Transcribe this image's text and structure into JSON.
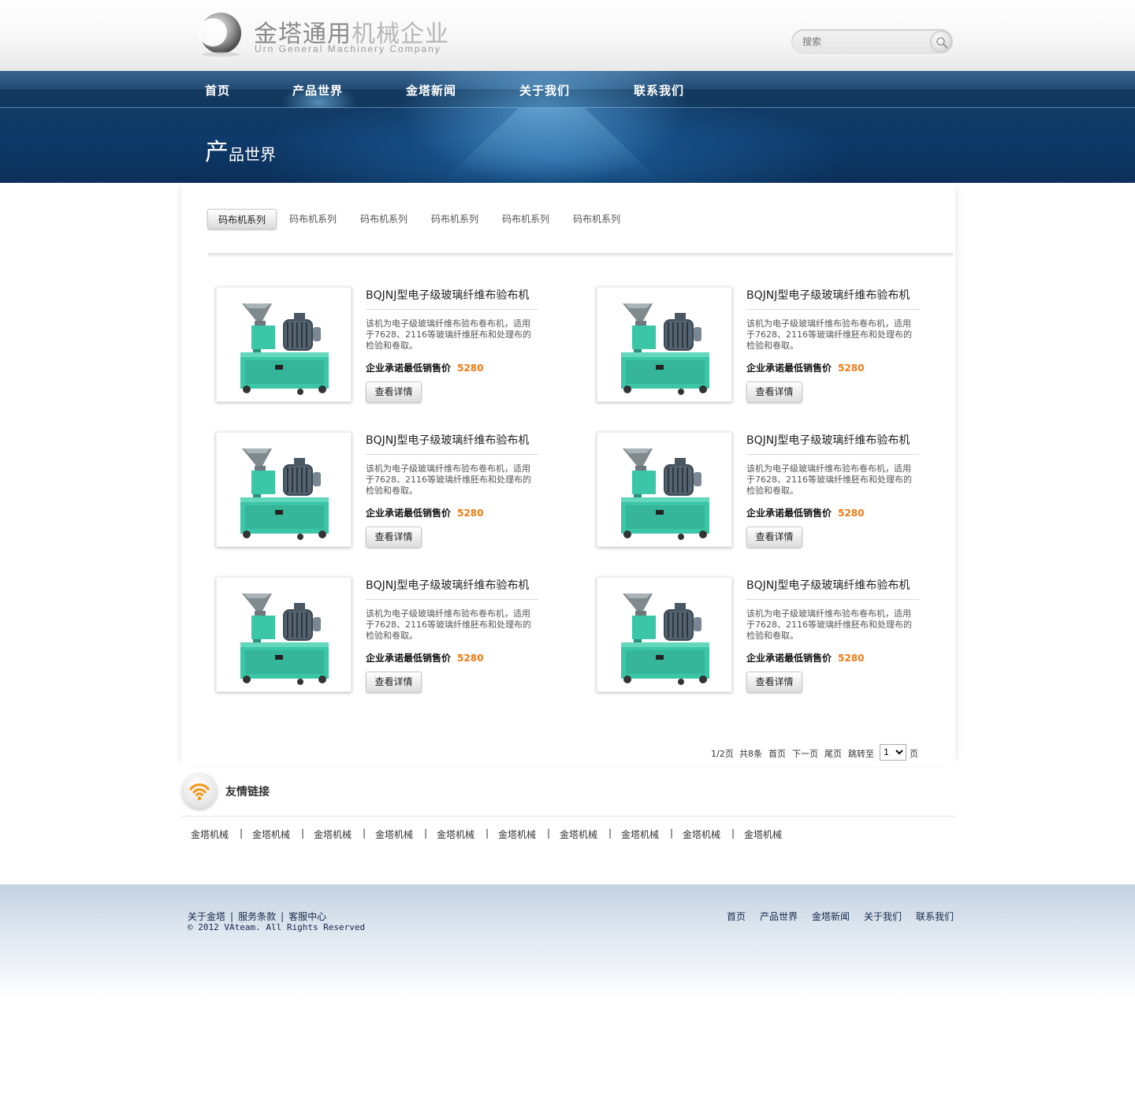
{
  "header": {
    "logo_cn_part1": "金塔通用",
    "logo_cn_part2": "机械企业",
    "logo_en": "Urn General Machinery Company",
    "search_placeholder": "搜索",
    "search_icon": "magnifier-icon"
  },
  "nav": {
    "items": [
      {
        "label": "首页"
      },
      {
        "label": "产品世界"
      },
      {
        "label": "金塔新闻"
      },
      {
        "label": "关于我们"
      },
      {
        "label": "联系我们"
      }
    ],
    "active": "产品世界"
  },
  "banner": {
    "title_big": "产",
    "title_rest": "品世界"
  },
  "tabs": [
    {
      "label": "码布机系列",
      "active": true
    },
    {
      "label": "码布机系列"
    },
    {
      "label": "码布机系列"
    },
    {
      "label": "码布机系列"
    },
    {
      "label": "码布机系列"
    },
    {
      "label": "码布机系列"
    }
  ],
  "products": [
    {
      "title": "BQJNJ型电子级玻璃纤维布验布机",
      "desc": "该机为电子级玻璃纤维布验布卷布机，适用于7628、2116等玻璃纤维胚布和处理布的检验和卷取。",
      "price_label": "企业承诺最低销售价",
      "price": "5280",
      "button": "查看详情"
    },
    {
      "title": "BQJNJ型电子级玻璃纤维布验布机",
      "desc": "该机为电子级玻璃纤维布验布卷布机，适用于7628、2116等玻璃纤维胚布和处理布的检验和卷取。",
      "price_label": "企业承诺最低销售价",
      "price": "5280",
      "button": "查看详情"
    },
    {
      "title": "BQJNJ型电子级玻璃纤维布验布机",
      "desc": "该机为电子级玻璃纤维布验布卷布机，适用于7628、2116等玻璃纤维胚布和处理布的检验和卷取。",
      "price_label": "企业承诺最低销售价",
      "price": "5280",
      "button": "查看详情"
    },
    {
      "title": "BQJNJ型电子级玻璃纤维布验布机",
      "desc": "该机为电子级玻璃纤维布验布卷布机，适用于7628、2116等玻璃纤维胚布和处理布的检验和卷取。",
      "price_label": "企业承诺最低销售价",
      "price": "5280",
      "button": "查看详情"
    },
    {
      "title": "BQJNJ型电子级玻璃纤维布验布机",
      "desc": "该机为电子级玻璃纤维布验布卷布机，适用于7628、2116等玻璃纤维胚布和处理布的检验和卷取。",
      "price_label": "企业承诺最低销售价",
      "price": "5280",
      "button": "查看详情"
    },
    {
      "title": "BQJNJ型电子级玻璃纤维布验布机",
      "desc": "该机为电子级玻璃纤维布验布卷布机，适用于7628、2116等玻璃纤维胚布和处理布的检验和卷取。",
      "price_label": "企业承诺最低销售价",
      "price": "5280",
      "button": "查看详情"
    }
  ],
  "pager": {
    "page_info": "1/2页",
    "total": "共8条",
    "first": "首页",
    "next": "下一页",
    "last": "尾页",
    "jump_label": "跳转至",
    "jump_value": "1",
    "page_suffix": "页"
  },
  "friend_links": {
    "title": "友情链接",
    "icon": "rss-icon",
    "items": [
      "金塔机械",
      "金塔机械",
      "金塔机械",
      "金塔机械",
      "金塔机械",
      "金塔机械",
      "金塔机械",
      "金塔机械",
      "金塔机械",
      "金塔机械"
    ],
    "separator": "|"
  },
  "footer": {
    "left_links": [
      "关于金塔",
      "服务条款",
      "客服中心"
    ],
    "separator": "|",
    "copyright": "© 2012 VAteam. All Rights Reserved",
    "right_links": [
      "首页",
      "产品世界",
      "金塔新闻",
      "关于我们",
      "联系我们"
    ]
  },
  "colors": {
    "price": "#f07a12",
    "nav_bg": "#123a63",
    "footer_text": "#14284a",
    "machine_body": "#3cc6a8"
  }
}
